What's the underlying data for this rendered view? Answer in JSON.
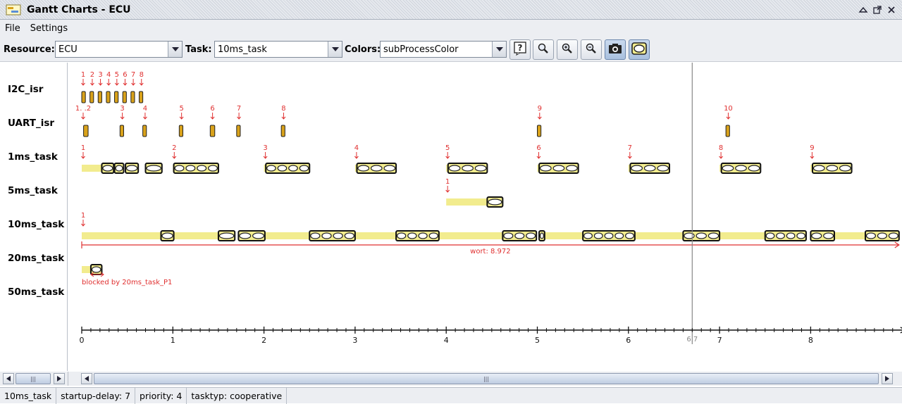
{
  "window": {
    "title": "Gantt Charts - ECU",
    "app_icon": "gantt-chart-icon",
    "controls": [
      "minimize-icon",
      "restore-icon",
      "close-icon"
    ]
  },
  "menu": [
    "File",
    "Settings"
  ],
  "toolbar": {
    "resource_label": "Resource:",
    "resource_value": "ECU",
    "task_label": "Task:",
    "task_value": "10ms_task",
    "colors_label": "Colors:",
    "colors_value": "subProcessColor",
    "buttons": [
      "help-icon",
      "zoom-icon",
      "zoom-in-icon",
      "zoom-out-icon",
      "screenshot-icon",
      "toggle-view-icon"
    ]
  },
  "chart_data": {
    "type": "gantt",
    "x_range": [
      0,
      8.97
    ],
    "x_ticks": [
      "0",
      "1",
      "2",
      "3",
      "4",
      "5",
      "6",
      "7",
      "8"
    ],
    "x_unit": "t",
    "cursor": {
      "x": 6.7,
      "label": "6.7"
    },
    "colors": {
      "fill": "#f2ec8e",
      "running": "#d9a21a",
      "marker": "#e03030"
    },
    "rows": [
      {
        "name": "I2C_isr",
        "runs": [
          [
            0.0,
            0.04
          ],
          [
            0.09,
            0.13
          ],
          [
            0.18,
            0.22
          ],
          [
            0.27,
            0.31
          ],
          [
            0.36,
            0.4
          ],
          [
            0.45,
            0.49
          ],
          [
            0.54,
            0.58
          ],
          [
            0.63,
            0.67
          ]
        ],
        "waits": [],
        "markers": [
          {
            "x": 0.0,
            "label": "1"
          },
          {
            "x": 0.1,
            "label": "2"
          },
          {
            "x": 0.19,
            "label": "3"
          },
          {
            "x": 0.28,
            "label": "4"
          },
          {
            "x": 0.37,
            "label": "5"
          },
          {
            "x": 0.46,
            "label": "6"
          },
          {
            "x": 0.55,
            "label": "7"
          },
          {
            "x": 0.64,
            "label": "8"
          }
        ]
      },
      {
        "name": "UART_isr",
        "runs": [
          [
            0.02,
            0.07
          ],
          [
            0.42,
            0.46
          ],
          [
            0.67,
            0.71
          ],
          [
            1.07,
            1.11
          ],
          [
            1.41,
            1.46
          ],
          [
            1.7,
            1.74
          ],
          [
            2.19,
            2.23
          ],
          [
            5.0,
            5.04
          ],
          [
            7.07,
            7.11
          ]
        ],
        "waits": [],
        "markers": [
          {
            "x": 0.0,
            "label": "1. .2"
          },
          {
            "x": 0.43,
            "label": "3"
          },
          {
            "x": 0.68,
            "label": "4"
          },
          {
            "x": 1.08,
            "label": "5"
          },
          {
            "x": 1.42,
            "label": "6"
          },
          {
            "x": 1.71,
            "label": "7"
          },
          {
            "x": 2.2,
            "label": "8"
          },
          {
            "x": 5.01,
            "label": "9"
          },
          {
            "x": 7.08,
            "label": "10"
          }
        ]
      },
      {
        "name": "1ms_task",
        "runs": [
          [
            0.22,
            0.35
          ],
          [
            0.36,
            0.46
          ],
          [
            0.48,
            0.62
          ],
          [
            0.7,
            0.88
          ],
          [
            1.01,
            1.5
          ],
          [
            2.02,
            2.5
          ],
          [
            3.02,
            3.45
          ],
          [
            4.02,
            4.45
          ],
          [
            5.02,
            5.45
          ],
          [
            6.02,
            6.45
          ],
          [
            7.02,
            7.45
          ],
          [
            8.02,
            8.45
          ]
        ],
        "waits": [
          [
            0.0,
            0.22
          ],
          [
            1.0,
            1.01
          ],
          [
            2.0,
            2.02
          ],
          [
            3.0,
            3.02
          ],
          [
            4.0,
            4.02
          ],
          [
            5.0,
            5.02
          ],
          [
            6.0,
            6.02
          ],
          [
            7.0,
            7.02
          ],
          [
            8.0,
            8.02
          ]
        ],
        "markers": [
          {
            "x": 0.0,
            "label": "1"
          },
          {
            "x": 1.0,
            "label": "2"
          },
          {
            "x": 2.0,
            "label": "3"
          },
          {
            "x": 3.0,
            "label": "4"
          },
          {
            "x": 4.0,
            "label": "5"
          },
          {
            "x": 5.0,
            "label": "6"
          },
          {
            "x": 6.0,
            "label": "7"
          },
          {
            "x": 7.0,
            "label": "8"
          },
          {
            "x": 8.0,
            "label": "9"
          }
        ]
      },
      {
        "name": "5ms_task",
        "runs": [
          [
            4.45,
            4.62
          ]
        ],
        "waits": [
          [
            4.0,
            4.45
          ]
        ],
        "markers": [
          {
            "x": 4.0,
            "label": "1"
          }
        ]
      },
      {
        "name": "10ms_task",
        "runs": [
          [
            0.87,
            1.01
          ],
          [
            1.5,
            1.68
          ],
          [
            1.72,
            2.01
          ],
          [
            2.5,
            3.0
          ],
          [
            3.45,
            3.92
          ],
          [
            4.62,
            4.99
          ],
          [
            5.02,
            5.08
          ],
          [
            5.5,
            6.07
          ],
          [
            6.6,
            7.0
          ],
          [
            7.5,
            7.95
          ],
          [
            8.0,
            8.26
          ],
          [
            8.6,
            8.97
          ]
        ],
        "waits": [
          [
            0.0,
            0.87
          ],
          [
            1.01,
            1.5
          ],
          [
            2.01,
            2.5
          ],
          [
            3.0,
            3.45
          ],
          [
            3.92,
            4.62
          ],
          [
            5.08,
            5.5
          ],
          [
            6.07,
            6.6
          ],
          [
            7.0,
            7.5
          ],
          [
            8.26,
            8.6
          ]
        ],
        "markers": [
          {
            "x": 0.0,
            "label": "1"
          }
        ],
        "span": {
          "from": 0.0,
          "to": 8.97,
          "label": "wort: 8.972"
        }
      },
      {
        "name": "20ms_task",
        "runs": [
          [
            0.1,
            0.22
          ]
        ],
        "waits": [
          [
            0.0,
            0.1
          ]
        ],
        "markers": [],
        "note": "blocked by 20ms_task_P1"
      },
      {
        "name": "50ms_task",
        "runs": [],
        "waits": [],
        "markers": []
      }
    ]
  },
  "scroll": {
    "left_thumb": "|||",
    "main_thumb": "|||"
  },
  "status": [
    "10ms_task",
    "startup-delay: 7",
    "priority: 4",
    "tasktyp: cooperative"
  ]
}
